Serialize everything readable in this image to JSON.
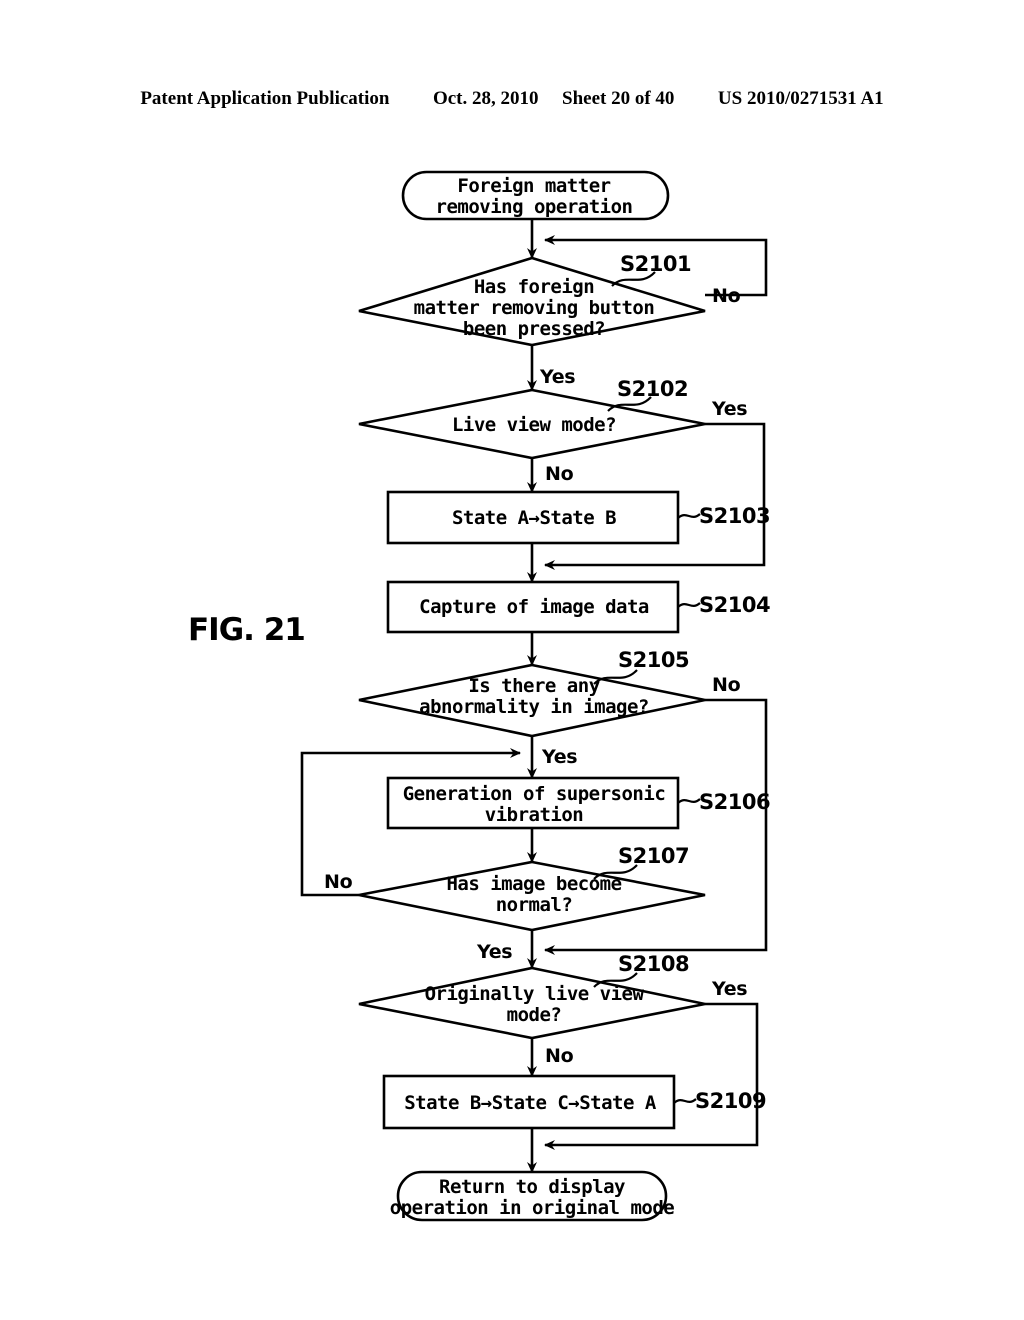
{
  "header": {
    "publication": "Patent Application Publication",
    "date": "Oct. 28, 2010",
    "sheet": "Sheet 20 of 40",
    "number": "US 2010/0271531 A1"
  },
  "figure": {
    "label": "FIG. 21"
  },
  "flowchart": {
    "start": {
      "line1": "Foreign matter",
      "line2": "removing operation"
    },
    "end": {
      "line1": "Return to display",
      "line2": "operation in original mode"
    },
    "nodes": [
      {
        "id": "S2101",
        "type": "decision",
        "step": "S2101",
        "line1": "Has foreign",
        "line2": "matter removing button",
        "line3": "been pressed?",
        "yes": "Yes",
        "no": "No"
      },
      {
        "id": "S2102",
        "type": "decision",
        "step": "S2102",
        "line1": "Live view mode?",
        "yes": "Yes",
        "no": "No"
      },
      {
        "id": "S2103",
        "type": "process",
        "step": "S2103",
        "line1": "State A→State B"
      },
      {
        "id": "S2104",
        "type": "process",
        "step": "S2104",
        "line1": "Capture of image data"
      },
      {
        "id": "S2105",
        "type": "decision",
        "step": "S2105",
        "line1": "Is there any",
        "line2": "abnormality in image?",
        "yes": "Yes",
        "no": "No"
      },
      {
        "id": "S2106",
        "type": "process",
        "step": "S2106",
        "line1": "Generation of supersonic",
        "line2": "vibration"
      },
      {
        "id": "S2107",
        "type": "decision",
        "step": "S2107",
        "line1": "Has image become",
        "line2": "normal?",
        "yes": "Yes",
        "no": "No"
      },
      {
        "id": "S2108",
        "type": "decision",
        "step": "S2108",
        "line1": "Originally live view",
        "line2": "mode?",
        "yes": "Yes",
        "no": "No"
      },
      {
        "id": "S2109",
        "type": "process",
        "step": "S2109",
        "line1": "State B→State C→State A"
      }
    ]
  },
  "colors": {
    "ink": "#000000",
    "paper": "#ffffff"
  }
}
